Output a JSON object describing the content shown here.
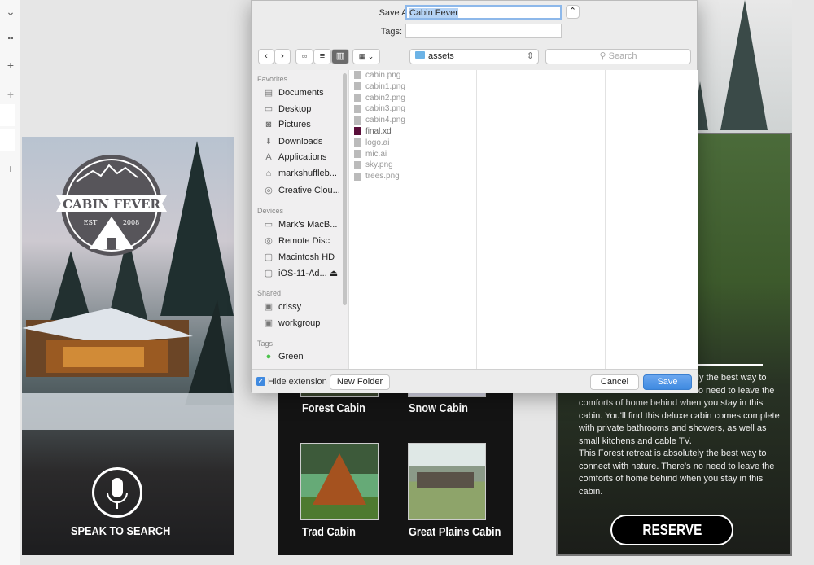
{
  "left_toolbar": {
    "icons": [
      "chevron-down-icon",
      "grid-icon",
      "plus-icon",
      "plus-icon",
      "plus-icon"
    ]
  },
  "artboard_home": {
    "logo_text": "CABIN FEVER",
    "logo_est": "EST",
    "logo_year": "2008",
    "cta": "SPEAK TO SEARCH"
  },
  "artboard_list": {
    "items": [
      {
        "label": "Forest Cabin"
      },
      {
        "label": "Snow Cabin"
      },
      {
        "label": "Trad Cabin"
      },
      {
        "label": "Great Plains Cabin"
      }
    ]
  },
  "artboard_detail": {
    "description_top": "This Forest retreat is absolutely the best way to connect with nature. There's no need to leave the comforts of home behind when you stay in this cabin. You'll find this deluxe cabin comes complete with private bathrooms and showers, as well as small kitchens and cable TV.",
    "description_bottom": "This Forest retreat is absolutely the best way to connect with nature. There's no need to leave the comforts of home behind when you stay in this cabin.",
    "reserve_label": "RESERVE"
  },
  "dialog": {
    "save_as_label": "Save As:",
    "save_as_value": "Cabin Fever",
    "tags_label": "Tags:",
    "tags_value": "",
    "location": "assets",
    "search_placeholder": "Search",
    "sidebar": {
      "favorites_header": "Favorites",
      "favorites": [
        {
          "label": "Documents",
          "icon": "documents-icon"
        },
        {
          "label": "Desktop",
          "icon": "desktop-icon"
        },
        {
          "label": "Pictures",
          "icon": "camera-icon"
        },
        {
          "label": "Downloads",
          "icon": "download-icon"
        },
        {
          "label": "Applications",
          "icon": "applications-icon"
        },
        {
          "label": "markshuffleb...",
          "icon": "home-icon"
        },
        {
          "label": "Creative Clou...",
          "icon": "creative-cloud-icon"
        }
      ],
      "devices_header": "Devices",
      "devices": [
        {
          "label": "Mark's MacB...",
          "icon": "laptop-icon"
        },
        {
          "label": "Remote Disc",
          "icon": "disc-icon"
        },
        {
          "label": "Macintosh HD",
          "icon": "drive-icon"
        },
        {
          "label": "iOS-11-Ad...",
          "icon": "drive-icon"
        }
      ],
      "shared_header": "Shared",
      "shared": [
        {
          "label": "crissy",
          "icon": "monitor-icon"
        },
        {
          "label": "workgroup",
          "icon": "monitor-icon"
        }
      ],
      "tags_header": "Tags",
      "tags": [
        {
          "label": "Green",
          "color": "#4cc34c"
        }
      ]
    },
    "files": [
      "cabin.png",
      "cabin1.png",
      "cabin2.png",
      "cabin3.png",
      "cabin4.png",
      "final.xd",
      "logo.ai",
      "mic.ai",
      "sky.png",
      "trees.png"
    ],
    "hide_extension_label": "Hide extension",
    "hide_extension_checked": true,
    "new_folder_label": "New Folder",
    "cancel_label": "Cancel",
    "save_label": "Save",
    "accent": "#3f8ae0"
  }
}
